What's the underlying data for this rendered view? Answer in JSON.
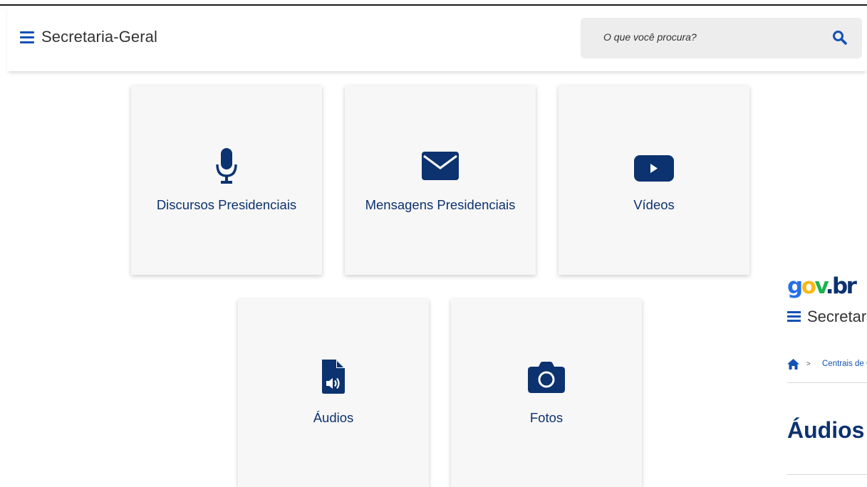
{
  "header": {
    "site_title": "Secretaria-Geral",
    "search_placeholder": "O que você procura?",
    "menu_icon": "hamburger-menu-icon",
    "search_icon": "search-icon"
  },
  "cards": [
    {
      "label": "Discursos Presidenciais",
      "icon": "microphone-icon"
    },
    {
      "label": "Mensagens Presidenciais",
      "icon": "envelope-icon"
    },
    {
      "label": "Vídeos",
      "icon": "youtube-play-icon"
    },
    {
      "label": "Áudios",
      "icon": "audio-file-icon"
    },
    {
      "label": "Fotos",
      "icon": "camera-icon"
    }
  ],
  "secondary_page": {
    "logo_parts": [
      "g",
      "o",
      "v",
      ".",
      "br"
    ],
    "site_title": "Secretaria-Geral",
    "breadcrumb_home_icon": "home-icon",
    "breadcrumb_separator": ">",
    "breadcrumb_link": "Centrais de Conteúdo",
    "page_title": "Áudios"
  },
  "colors": {
    "primary_blue": "#1351b4",
    "dark_blue": "#0c326f",
    "gov_blue": "#2670e8",
    "gov_yellow": "#f8b914",
    "gov_green": "#1ab34d",
    "card_background": "#f7f7f7",
    "search_background": "#ededed"
  }
}
